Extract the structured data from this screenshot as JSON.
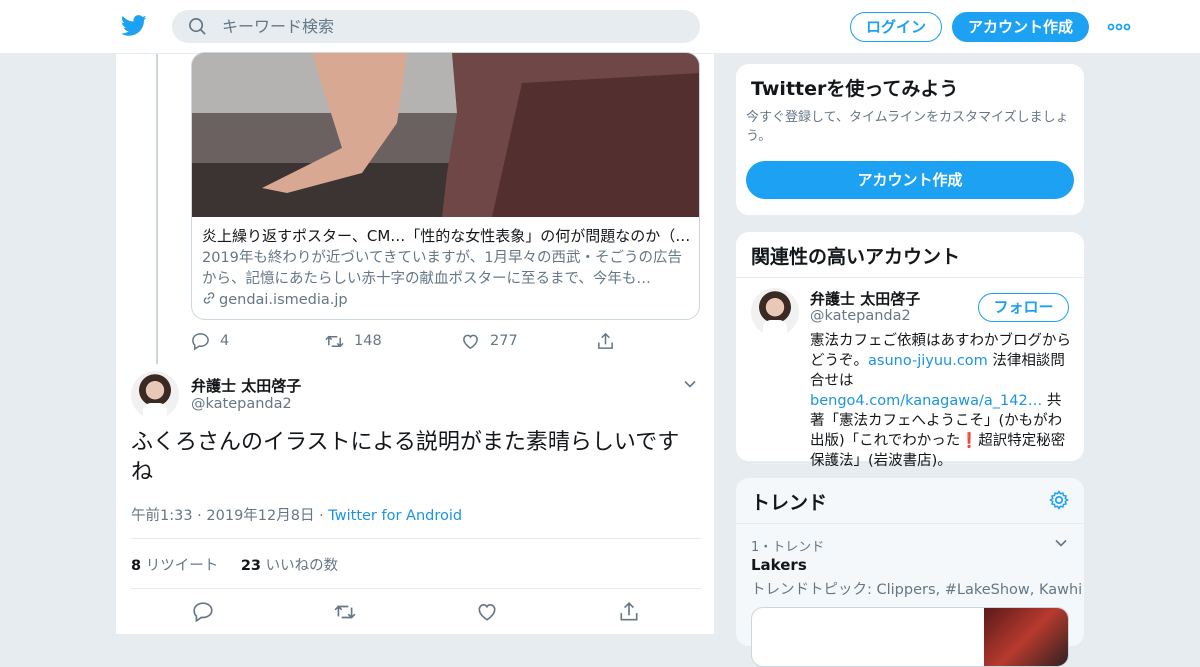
{
  "header": {
    "search_placeholder": "キーワード検索",
    "login_label": "ログイン",
    "signup_label": "アカウント作成"
  },
  "quoted_card": {
    "title": "炎上繰り返すポスター、CM…「性的な女性表象」の何が問題なのか（…",
    "description": "2019年も終わりが近づいてきていますが、1月早々の西武・そごうの広告から、記憶にあたらしい赤十字の献血ポスターに至るまで、今年も…",
    "domain": "gendai.ismedia.jp"
  },
  "previous_actions": {
    "replies": "4",
    "retweets": "148",
    "likes": "277"
  },
  "tweet": {
    "name": "弁護士 太田啓子",
    "handle": "@katepanda2",
    "text": "ふくろさんのイラストによる説明がまた素晴らしいですね",
    "time": "午前1:33 · 2019年12月8日 ·",
    "source": "Twitter for Android",
    "retweet_count": "8",
    "retweet_label": "リツイート",
    "like_count": "23",
    "like_label": "いいねの数"
  },
  "sidebar": {
    "signup_title": "Twitterを使ってみよう",
    "signup_text": "今すぐ登録して、タイムラインをカスタマイズしましょう。",
    "signup_button": "アカウント作成",
    "related_title": "関連性の高いアカウント",
    "related_name": "弁護士 太田啓子",
    "related_handle": "@katepanda2",
    "follow_label": "フォロー",
    "bio_1": "憲法カフェご依頼はあすわかブログからどうぞ。",
    "bio_link1": "asuno-jiyuu.com",
    "bio_2": " 法律相談問合せは",
    "bio_link2": "bengo4.com/kanagawa/a_142…",
    "bio_3": " 共著「憲法カフェへようこそ」(かもがわ出版)「これでわかった❗超訳特定秘密保護法」(岩波書店)。",
    "trends_title": "トレンド",
    "trend_rank": "1・トレンド",
    "trend_name": "Lakers",
    "trend_sub": "トレンドトピック: Clippers, #LakeShow, Kawhi"
  },
  "colors": {
    "accent": "#1da1f2",
    "link": "#1b95e0",
    "muted": "#657786"
  },
  "icons": [
    "twitter-bird-icon",
    "search-icon",
    "more-icon",
    "link-icon",
    "reply-icon",
    "retweet-icon",
    "like-icon",
    "share-icon",
    "chevron-down-icon",
    "gear-icon"
  ]
}
